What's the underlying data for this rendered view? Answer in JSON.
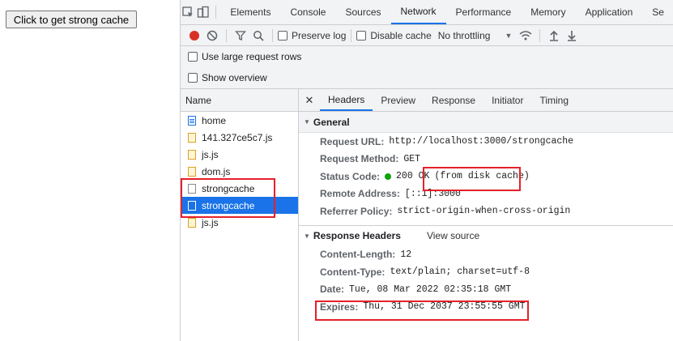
{
  "page": {
    "button_label": "Click to get strong cache"
  },
  "devtools": {
    "tabs": [
      "Elements",
      "Console",
      "Sources",
      "Network",
      "Performance",
      "Memory",
      "Application",
      "Se"
    ],
    "active_tab": "Network",
    "toolbar": {
      "preserve_log": "Preserve log",
      "disable_cache": "Disable cache",
      "throttling": "No throttling"
    },
    "options": {
      "large_rows": "Use large request rows",
      "overview": "Show overview"
    },
    "request_list": {
      "header": "Name",
      "items": [
        {
          "name": "home",
          "icon": "document-icon"
        },
        {
          "name": "141.327ce5c7.js",
          "icon": "script-icon"
        },
        {
          "name": "js.js",
          "icon": "script-icon"
        },
        {
          "name": "dom.js",
          "icon": "script-icon"
        },
        {
          "name": "strongcache",
          "icon": "blank-file-icon"
        },
        {
          "name": "strongcache",
          "icon": "blank-file-icon"
        },
        {
          "name": "js.js",
          "icon": "script-icon"
        }
      ],
      "selected_index": 5
    },
    "detail_tabs": [
      "Headers",
      "Preview",
      "Response",
      "Initiator",
      "Timing"
    ],
    "general": {
      "title": "General",
      "request_url_label": "Request URL:",
      "request_url": "http://localhost:3000/strongcache",
      "request_method_label": "Request Method:",
      "request_method": "GET",
      "status_code_label": "Status Code:",
      "status_code": "200 OK",
      "status_note": "(from disk cache)",
      "remote_address_label": "Remote Address:",
      "remote_address": "[::1]:3000",
      "referrer_policy_label": "Referrer Policy:",
      "referrer_policy": "strict-origin-when-cross-origin"
    },
    "response_headers": {
      "title": "Response Headers",
      "view_source": "View source",
      "content_length_label": "Content-Length:",
      "content_length": "12",
      "content_type_label": "Content-Type:",
      "content_type": "text/plain; charset=utf-8",
      "date_label": "Date:",
      "date": "Tue, 08 Mar 2022 02:35:18 GMT",
      "expires_label": "Expires:",
      "expires": "Thu, 31 Dec 2037 23:55:55 GMT"
    },
    "colors": {
      "accent": "#1a73e8",
      "highlight_box": "#e5202a",
      "status_ok": "#0ca30c"
    }
  }
}
